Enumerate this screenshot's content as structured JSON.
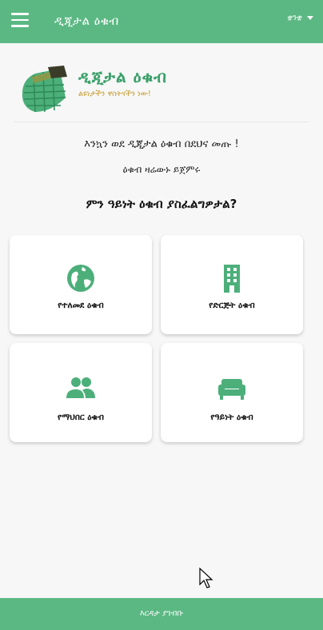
{
  "appbar": {
    "title": "ዲጂታል ዕቁብ",
    "language": "ቋንቋ",
    "menu_icon": "hamburger-menu-icon"
  },
  "header": {
    "brand": "ዲጂታል ዕቁብ",
    "tagline": "ልዩነታችን ዋስትናችን ነው!"
  },
  "welcome": {
    "line1": "እንኳን ወደ ዲጂታል ዕቁብ በደህና መጡ !",
    "line2": "ዕቁብ ዛሬውኑ ይጀምሩ",
    "question": "ምን ዓይነት ዕቁብ ያስፈልግዎታል?"
  },
  "cards": [
    {
      "label": "የተለመደ ዕቁብ",
      "icon": "globe-icon"
    },
    {
      "label": "የድርጅት ዕቁብ",
      "icon": "building-icon"
    },
    {
      "label": "የማህበር ዕቁብ",
      "icon": "group-icon"
    },
    {
      "label": "የዓይነት ዕቁብ",
      "icon": "sofa-icon"
    }
  ],
  "footer": {
    "label": "እርዳታ ያገብቡ"
  },
  "colors": {
    "accent": "#5bb883",
    "brand_text": "#3aa06a",
    "tagline": "#c79a2a",
    "icon": "#4caf7a"
  }
}
